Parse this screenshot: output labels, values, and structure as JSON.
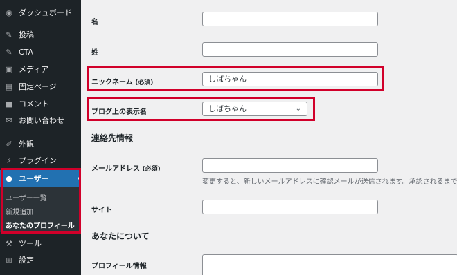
{
  "sidebar": {
    "items": [
      {
        "label": "ダッシュボード",
        "icon": "dashboard-icon"
      },
      {
        "label": "投稿",
        "icon": "pin-icon"
      },
      {
        "label": "CTA",
        "icon": "pin-icon"
      },
      {
        "label": "メディア",
        "icon": "media-icon"
      },
      {
        "label": "固定ページ",
        "icon": "page-icon"
      },
      {
        "label": "コメント",
        "icon": "comment-icon"
      },
      {
        "label": "お問い合わせ",
        "icon": "mail-icon"
      },
      {
        "label": "外観",
        "icon": "brush-icon"
      },
      {
        "label": "プラグイン",
        "icon": "plugin-icon"
      },
      {
        "label": "ユーザー",
        "icon": "user-icon"
      },
      {
        "label": "ツール",
        "icon": "wrench-icon"
      },
      {
        "label": "設定",
        "icon": "settings-icon"
      }
    ],
    "submenu": [
      {
        "label": "ユーザー一覧"
      },
      {
        "label": "新規追加"
      },
      {
        "label": "あなたのプロフィール"
      }
    ]
  },
  "form": {
    "first_name": {
      "label": "名",
      "value": ""
    },
    "last_name": {
      "label": "姓",
      "value": ""
    },
    "nickname": {
      "label": "ニックネーム",
      "required": "(必須)",
      "value": "しばちゃん"
    },
    "display_name": {
      "label": "ブログ上の表示名",
      "value": "しばちゃん"
    },
    "contact_section": "連絡先情報",
    "email": {
      "label": "メールアドレス",
      "required": "(必須)",
      "value": "",
      "description": "変更すると、新しいメールアドレスに確認メールが送信されます。承認されるまで"
    },
    "website": {
      "label": "サイト",
      "value": ""
    },
    "about_section": "あなたについて",
    "bio": {
      "label": "プロフィール情報",
      "value": ""
    }
  },
  "colors": {
    "highlight": "#d1002a",
    "accent": "#2271b1",
    "sidebar": "#1d2327"
  }
}
